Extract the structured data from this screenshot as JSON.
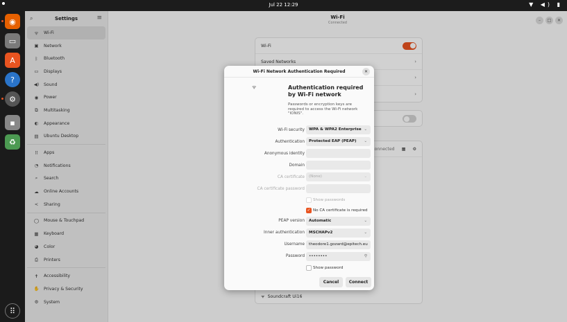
{
  "topbar": {
    "clock": "Jul 22  12:29",
    "tray": "▼ ◀) ▮"
  },
  "dock": [
    {
      "name": "firefox-icon",
      "glyph": "◉",
      "color": "#e66000"
    },
    {
      "name": "files-icon",
      "glyph": "▭",
      "color": "#7a7a7a"
    },
    {
      "name": "app-center-icon",
      "glyph": "A",
      "color": "#e95420"
    },
    {
      "name": "help-icon",
      "glyph": "?",
      "color": "#2a74c9"
    },
    {
      "name": "settings-icon",
      "glyph": "⚙",
      "color": "#555555"
    },
    {
      "name": "terminal-icon",
      "glyph": "▪",
      "color": "#888888"
    },
    {
      "name": "trash-icon",
      "glyph": "♻",
      "color": "#4c9a52"
    },
    {
      "name": "show-apps-icon",
      "glyph": "⠿",
      "color": "#1b1b1b"
    }
  ],
  "sidebar": {
    "title": "Settings",
    "items": [
      {
        "label": "Wi-Fi",
        "icon": "wifi-icon",
        "glyph": "ᯤ"
      },
      {
        "label": "Network",
        "icon": "network-icon",
        "glyph": "▣"
      },
      {
        "label": "Bluetooth",
        "icon": "bluetooth-icon",
        "glyph": "ᛒ"
      },
      {
        "label": "Displays",
        "icon": "display-icon",
        "glyph": "▭"
      },
      {
        "label": "Sound",
        "icon": "sound-icon",
        "glyph": "◀)"
      },
      {
        "label": "Power",
        "icon": "power-icon",
        "glyph": "◉"
      },
      {
        "label": "Multitasking",
        "icon": "multitasking-icon",
        "glyph": "⧉"
      },
      {
        "label": "Appearance",
        "icon": "appearance-icon",
        "glyph": "◐"
      },
      {
        "label": "Ubuntu Desktop",
        "icon": "ubuntu-desktop-icon",
        "glyph": "▤"
      },
      {
        "label": "Apps",
        "icon": "apps-icon",
        "glyph": "⠿"
      },
      {
        "label": "Notifications",
        "icon": "notifications-icon",
        "glyph": "◔"
      },
      {
        "label": "Search",
        "icon": "search-icon",
        "glyph": "⌕"
      },
      {
        "label": "Online Accounts",
        "icon": "cloud-icon",
        "glyph": "☁"
      },
      {
        "label": "Sharing",
        "icon": "share-icon",
        "glyph": "<"
      },
      {
        "label": "Mouse & Touchpad",
        "icon": "mouse-icon",
        "glyph": "◯"
      },
      {
        "label": "Keyboard",
        "icon": "keyboard-icon",
        "glyph": "▦"
      },
      {
        "label": "Color",
        "icon": "color-icon",
        "glyph": "◕"
      },
      {
        "label": "Printers",
        "icon": "printer-icon",
        "glyph": "⎙"
      },
      {
        "label": "Accessibility",
        "icon": "accessibility-icon",
        "glyph": "✝"
      },
      {
        "label": "Privacy & Security",
        "icon": "privacy-icon",
        "glyph": "✋"
      },
      {
        "label": "System",
        "icon": "system-icon",
        "glyph": "⚙"
      }
    ]
  },
  "main": {
    "title": "Wi-Fi",
    "subtitle": "Connected",
    "wifi_label": "Wi-Fi",
    "saved_networks": "Saved Networks",
    "connected_text": "Connected",
    "network_bottom": "Soundcraft Ui16"
  },
  "dialog": {
    "header": "Wi-Fi Network Authentication Required",
    "title": "Authentication required by Wi-Fi network",
    "description": "Passwords or encryption keys are required to access the Wi-Fi network \"IONIS\".",
    "fields": {
      "security_label": "Wi-Fi security",
      "security_value": "WPA & WPA2 Enterprise",
      "auth_label": "Authentication",
      "auth_value": "Protected EAP (PEAP)",
      "anon_label": "Anonymous identity",
      "anon_value": "",
      "domain_label": "Domain",
      "domain_value": "",
      "ca_cert_label": "CA certificate",
      "ca_cert_value": "(None)",
      "ca_pass_label": "CA certificate password",
      "ca_pass_value": "",
      "show_passwords_label": "Show passwords",
      "no_ca_label": "No CA certificate is required",
      "peap_label": "PEAP version",
      "peap_value": "Automatic",
      "inner_auth_label": "Inner authentication",
      "inner_auth_value": "MSCHAPv2",
      "username_label": "Username",
      "username_value": "theodore1.gozard@epitech.eu",
      "password_label": "Password",
      "password_value": "••••••••",
      "show_password_label": "Show password"
    },
    "cancel_label": "Cancel",
    "connect_label": "Connect"
  }
}
